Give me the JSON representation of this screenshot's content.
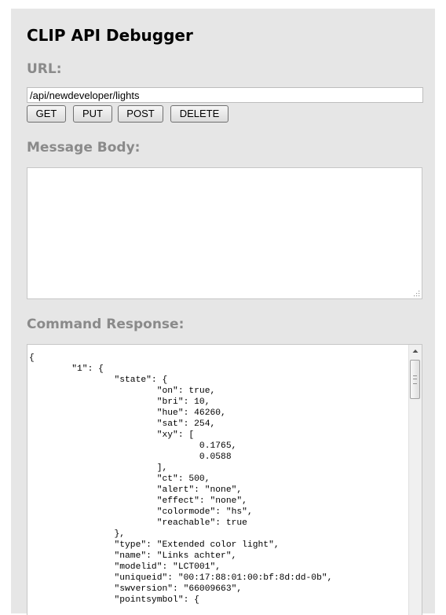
{
  "header": {
    "title": "CLIP API Debugger"
  },
  "url_section": {
    "label": "URL:",
    "value": "/api/newdeveloper/lights"
  },
  "buttons": {
    "get": "GET",
    "put": "PUT",
    "post": "POST",
    "delete": "DELETE"
  },
  "message_body": {
    "label": "Message Body:",
    "value": ""
  },
  "command_response": {
    "label": "Command Response:",
    "lines": [
      "{",
      "        \"1\": {",
      "                \"state\": {",
      "                        \"on\": true,",
      "                        \"bri\": 10,",
      "                        \"hue\": 46260,",
      "                        \"sat\": 254,",
      "                        \"xy\": [",
      "                                0.1765,",
      "                                0.0588",
      "                        ],",
      "                        \"ct\": 500,",
      "                        \"alert\": \"none\",",
      "                        \"effect\": \"none\",",
      "                        \"colormode\": \"hs\",",
      "                        \"reachable\": true",
      "                },",
      "                \"type\": \"Extended color light\",",
      "                \"name\": \"Links achter\",",
      "                \"modelid\": \"LCT001\",",
      "                \"uniqueid\": \"00:17:88:01:00:bf:8d:dd-0b\",",
      "                \"swversion\": \"66009663\",",
      "                \"pointsymbol\": {"
    ]
  },
  "icons": {
    "resize_grip": "resize-grip-icon",
    "scroll_up": "scroll-up-arrow-icon"
  }
}
